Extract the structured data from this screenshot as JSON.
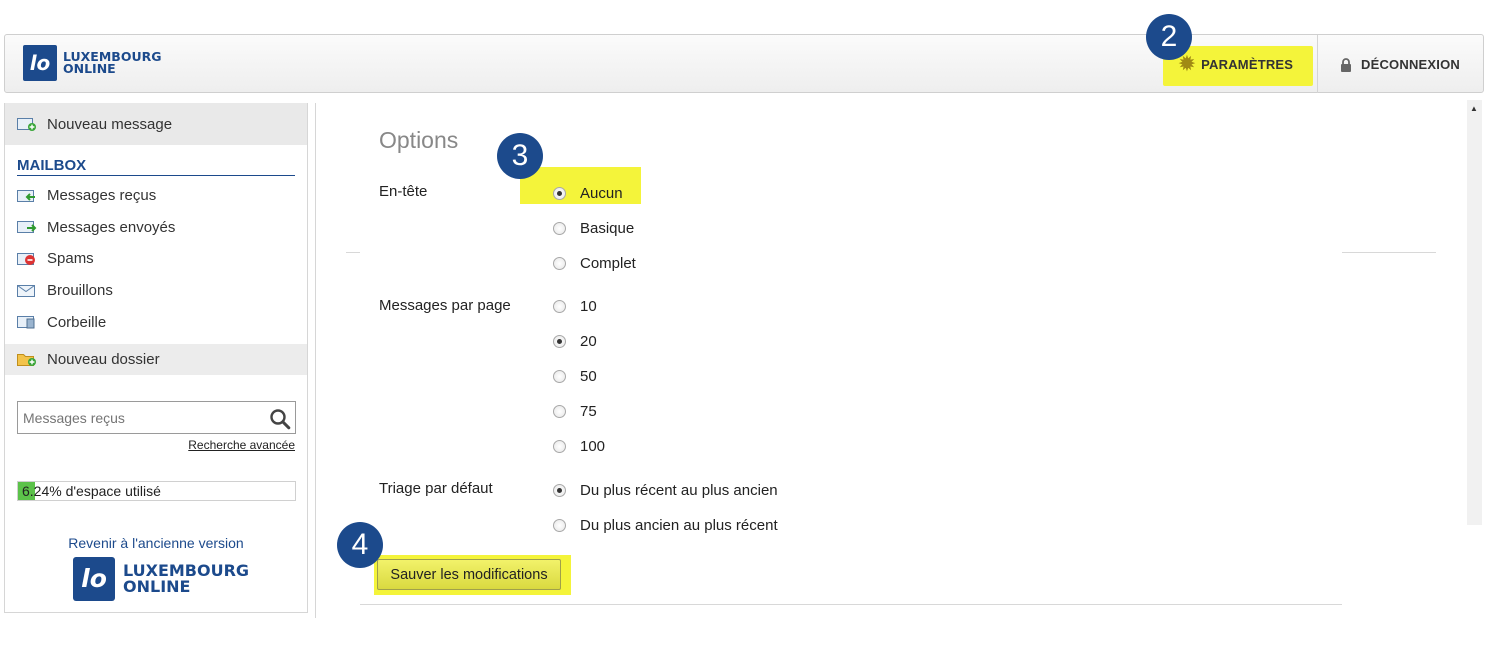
{
  "header": {
    "logo_line1": "LUXEMBOURG",
    "logo_line2": "ONLINE",
    "logo_mark": "lo",
    "settings_label": "PARAMÈTRES",
    "logout_label": "DÉCONNEXION",
    "highlight_color": "#f4f43a",
    "brand_color": "#1c4a8c"
  },
  "sidebar": {
    "new_message": "Nouveau message",
    "mailbox_title": "MAILBOX",
    "folders": [
      {
        "label": "Messages reçus",
        "icon": "inbox-icon"
      },
      {
        "label": "Messages envoyés",
        "icon": "sent-icon"
      },
      {
        "label": "Spams",
        "icon": "spam-icon"
      },
      {
        "label": "Brouillons",
        "icon": "drafts-icon"
      },
      {
        "label": "Corbeille",
        "icon": "trash-icon"
      }
    ],
    "new_folder": "Nouveau dossier",
    "search_placeholder": "Messages reçus",
    "advanced_search": "Recherche avancée",
    "usage_percent": 6.24,
    "usage_label": "6.24% d'espace utilisé",
    "old_version": "Revenir à l'ancienne version",
    "logo_line1": "LUXEMBOURG",
    "logo_line2": "ONLINE"
  },
  "options": {
    "title": "Options",
    "header_label": "En-tête",
    "header_choices": [
      {
        "label": "Aucun",
        "checked": true
      },
      {
        "label": "Basique",
        "checked": false
      },
      {
        "label": "Complet",
        "checked": false
      }
    ],
    "per_page_label": "Messages par page",
    "per_page_choices": [
      {
        "label": "10",
        "checked": false
      },
      {
        "label": "20",
        "checked": true
      },
      {
        "label": "50",
        "checked": false
      },
      {
        "label": "75",
        "checked": false
      },
      {
        "label": "100",
        "checked": false
      }
    ],
    "sort_label": "Triage par défaut",
    "sort_choices": [
      {
        "label": "Du plus récent au plus ancien",
        "checked": true
      },
      {
        "label": "Du plus ancien au plus récent",
        "checked": false
      }
    ],
    "save_button": "Sauver les modifications"
  },
  "steps": [
    "2",
    "3",
    "4"
  ]
}
